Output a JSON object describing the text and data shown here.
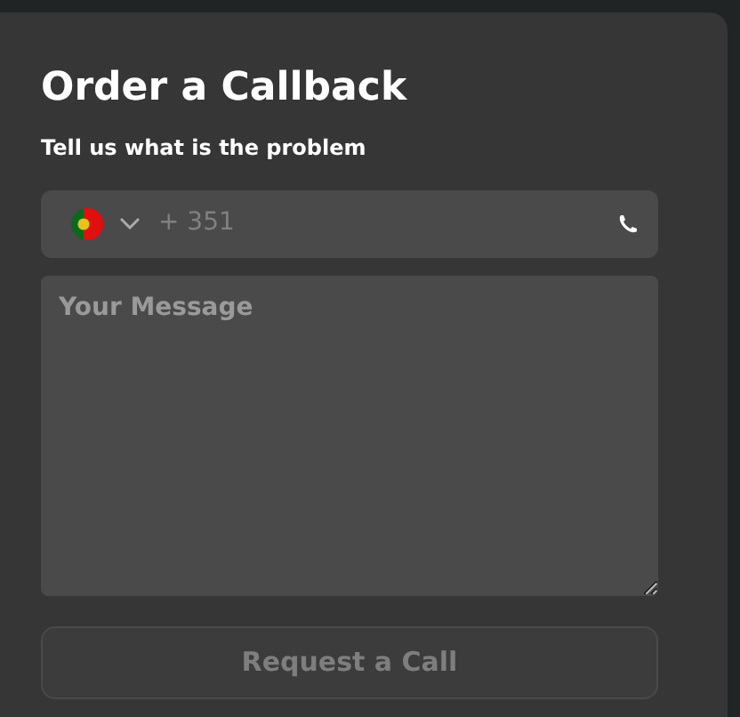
{
  "form": {
    "title": "Order a Callback",
    "subtitle": "Tell us what is the problem",
    "phone": {
      "placeholder": "+ 351"
    },
    "message": {
      "placeholder": "Your Message"
    },
    "submit": {
      "label": "Request a Call",
      "disabled": true
    }
  }
}
